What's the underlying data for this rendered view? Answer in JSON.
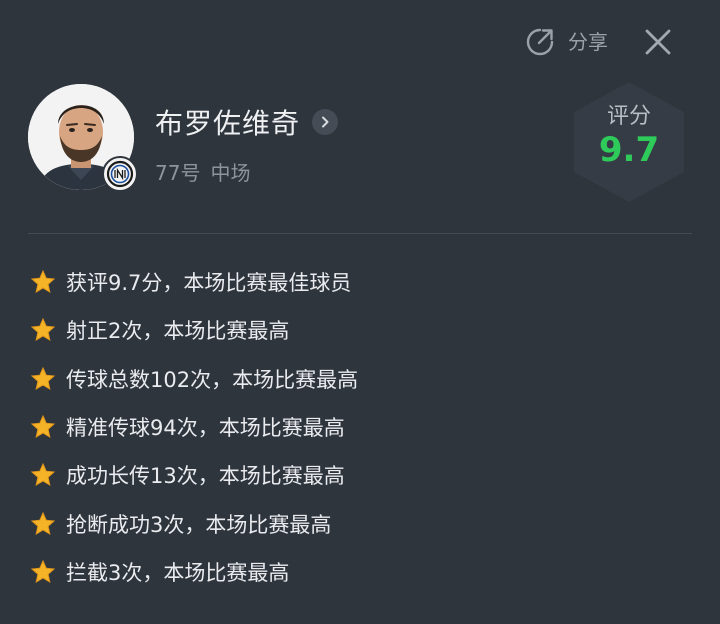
{
  "header": {
    "share_label": "分享"
  },
  "player": {
    "name": "布罗佐维奇",
    "number": "77号",
    "position": "中场"
  },
  "rating": {
    "label": "评分",
    "value": "9.7"
  },
  "highlights": [
    "获评9.7分，本场比赛最佳球员",
    "射正2次，本场比赛最高",
    "传球总数102次，本场比赛最高",
    "精准传球94次，本场比赛最高",
    "成功长传13次，本场比赛最高",
    "抢断成功3次，本场比赛最高",
    "拦截3次，本场比赛最高"
  ],
  "colors": {
    "background": "#2f353d",
    "rating_value": "#2ecb5b",
    "star": "#f5b327"
  },
  "icons": [
    "share-icon",
    "close-icon",
    "chevron-right-icon",
    "star-icon",
    "club-badge-icon"
  ]
}
